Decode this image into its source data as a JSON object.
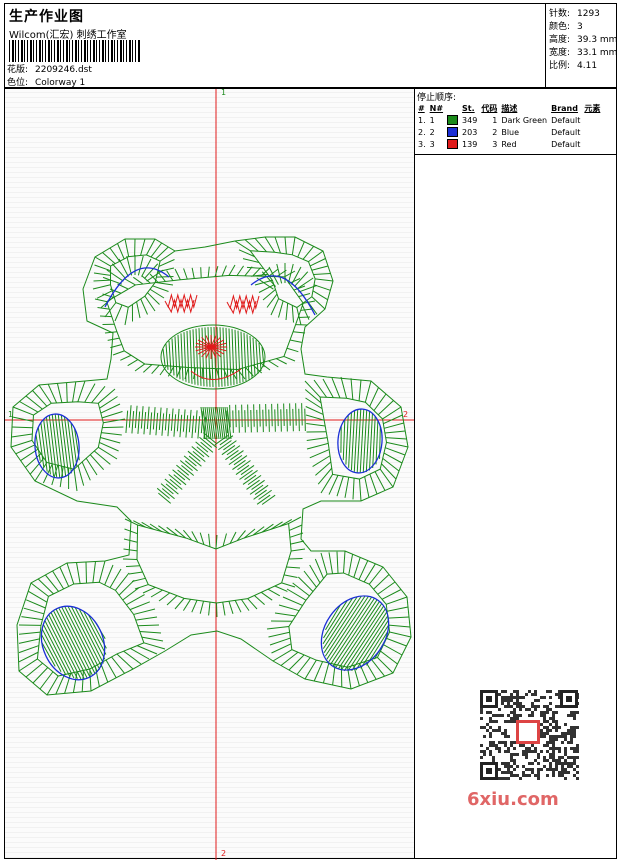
{
  "header": {
    "title": "生产作业图",
    "company": "Wilcom(汇宏) 刺绣工作室",
    "design_label": "花版:",
    "design_name": "2209246.dst",
    "colorway_label": "色位:",
    "colorway": "Colorway 1"
  },
  "stats": {
    "stitches_label": "针数:",
    "stitches": "1293",
    "colors_label": "颜色:",
    "colors": "3",
    "height_label": "高度:",
    "height": "39.3 mm",
    "width_label": "宽度:",
    "width": "33.1 mm",
    "scale_label": "比例:",
    "scale": "4.11"
  },
  "stop_sequence": {
    "heading": "停止顺序:",
    "columns": [
      "#",
      "N#",
      "St.",
      "代码",
      "描述",
      "Brand",
      "元素"
    ],
    "rows": [
      {
        "idx": "1.",
        "n": "1",
        "color": "#1b8a1b",
        "st": "349",
        "code": "1",
        "desc": "Dark Green",
        "brand": "Default"
      },
      {
        "idx": "2.",
        "n": "2",
        "color": "#1b2fd6",
        "st": "203",
        "code": "2",
        "desc": "Blue",
        "brand": "Default"
      },
      {
        "idx": "3.",
        "n": "3",
        "color": "#e01b1b",
        "st": "139",
        "code": "3",
        "desc": "Red",
        "brand": "Default"
      }
    ]
  },
  "axes": {
    "top": "1",
    "bottom": "2",
    "left": "1",
    "right": "2"
  },
  "watermark": "6xiu.com",
  "colors": {
    "green": "#1b8a1b",
    "blue": "#1b2fd6",
    "red": "#e01b1b"
  }
}
